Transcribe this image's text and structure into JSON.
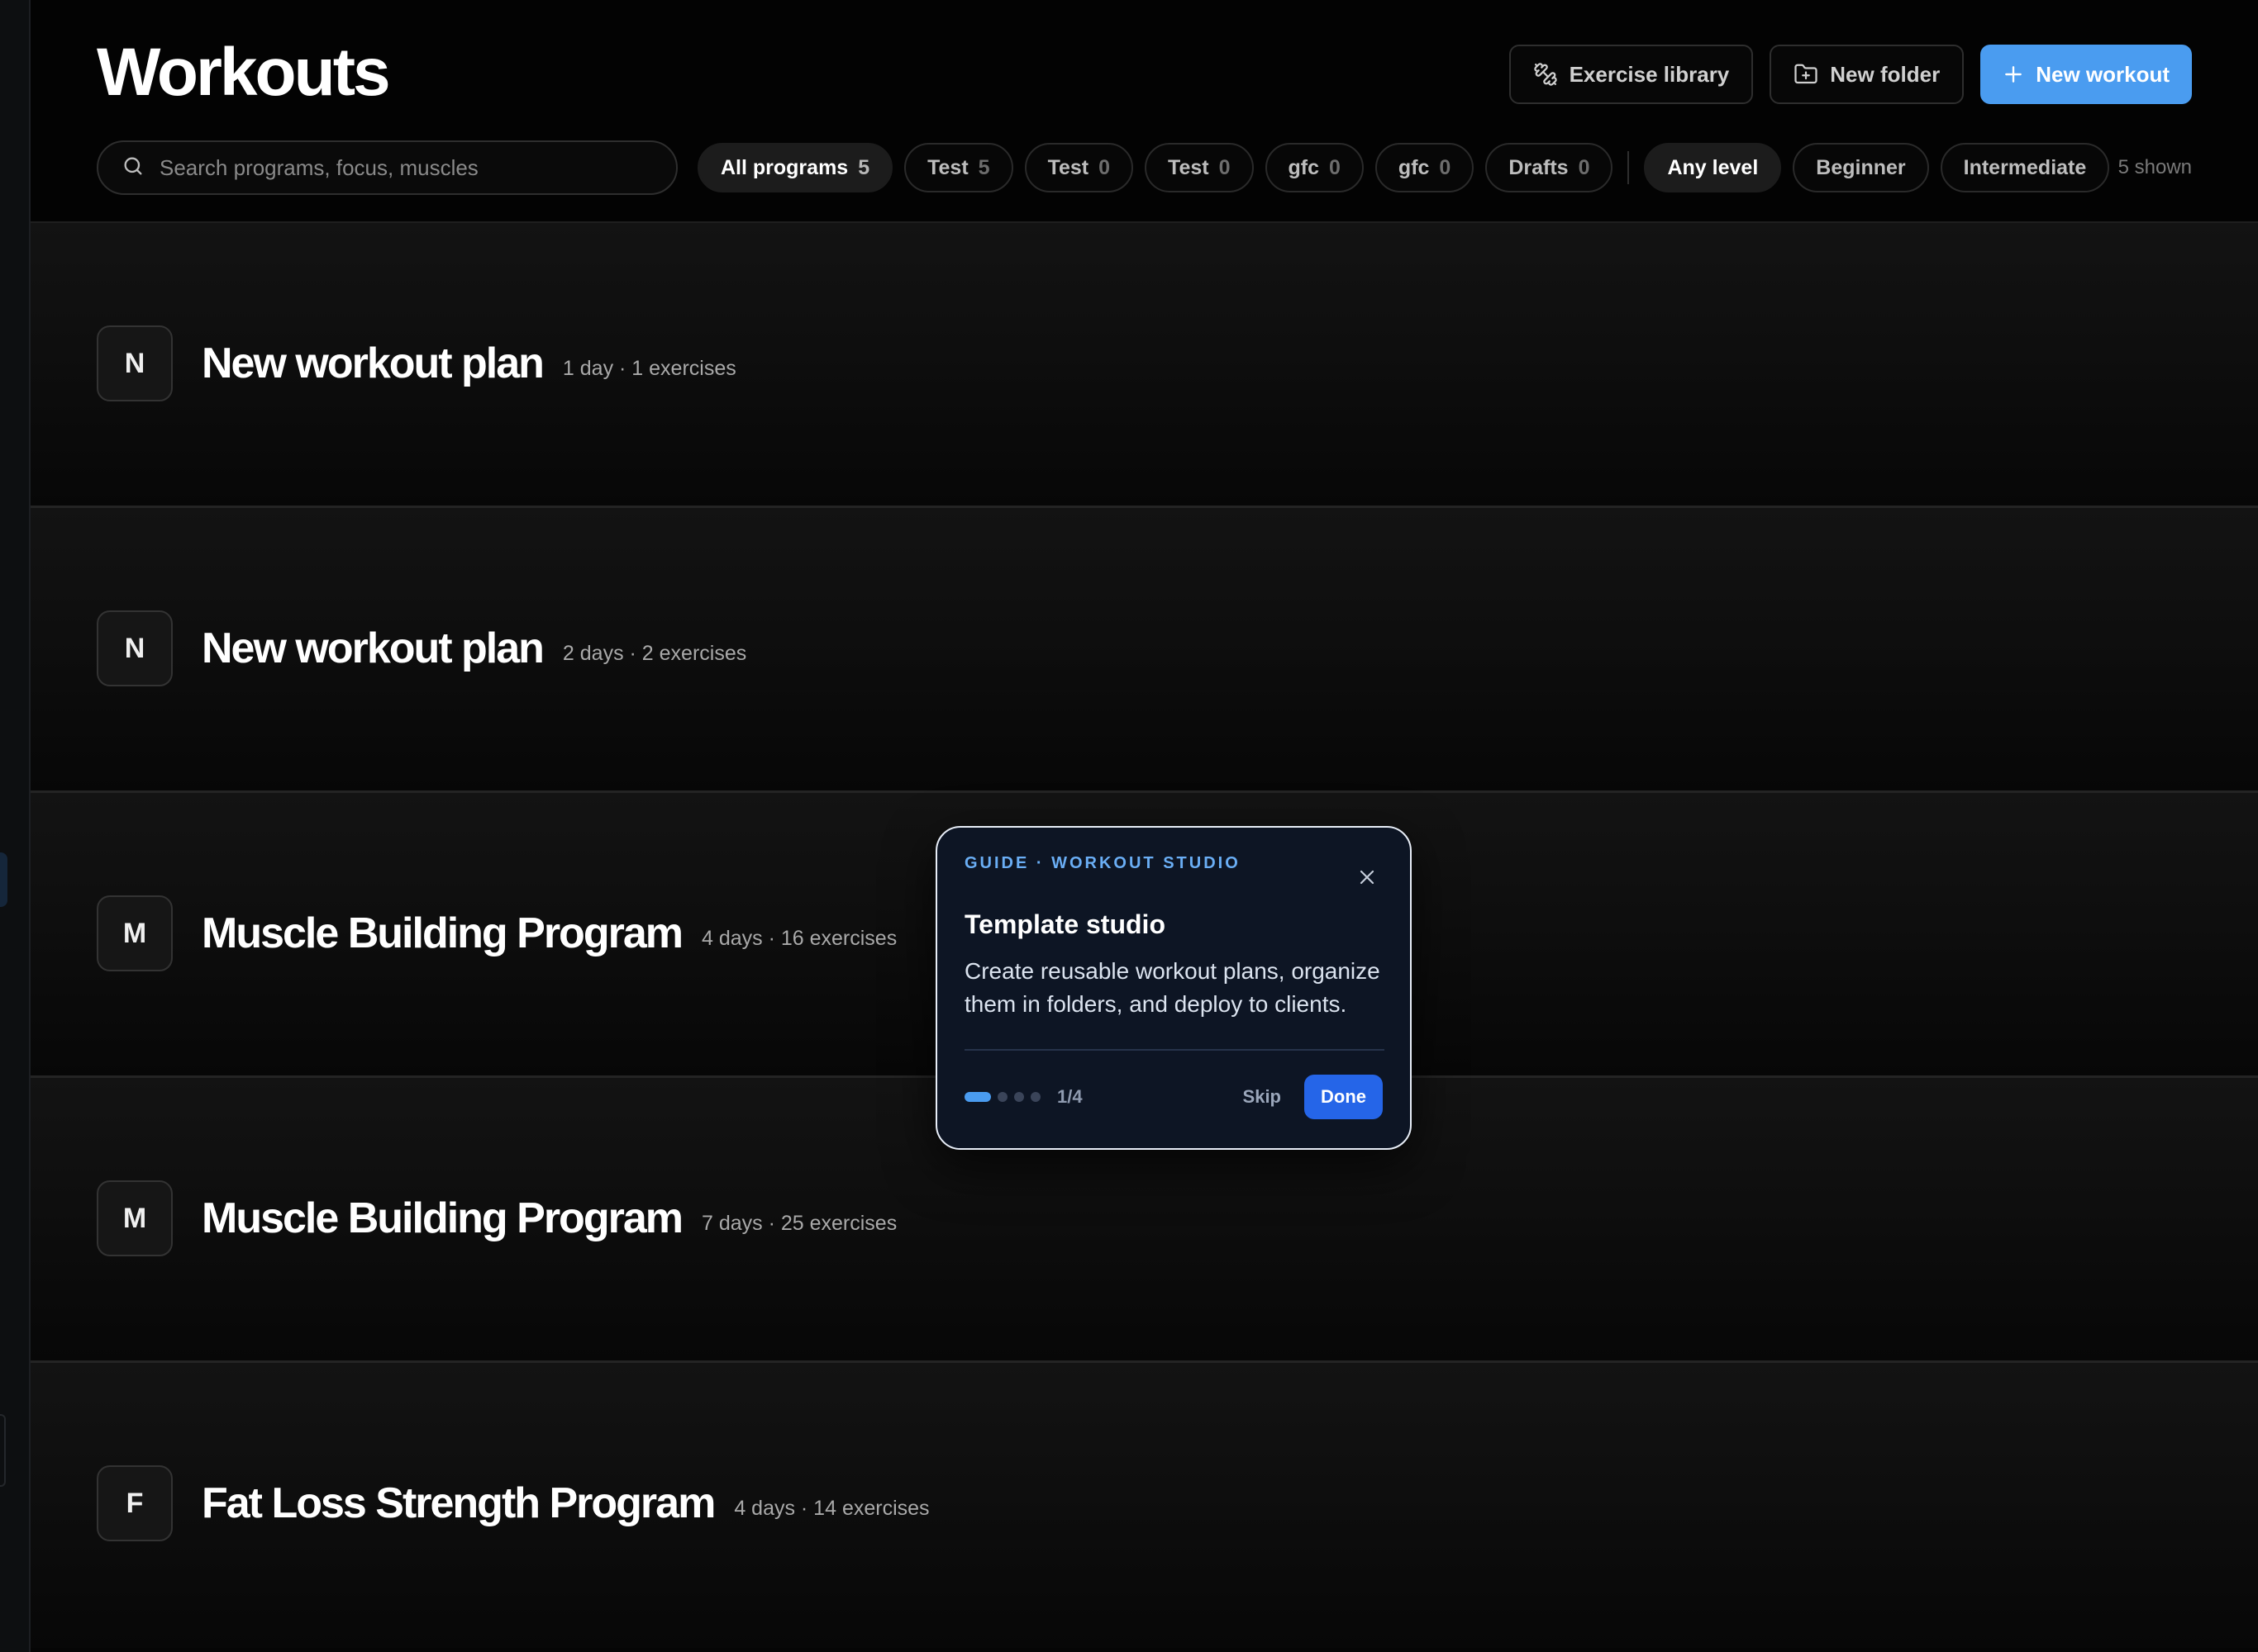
{
  "header": {
    "title": "Workouts",
    "actions": {
      "exercise_library": "Exercise library",
      "new_folder": "New folder",
      "new_workout": "New workout"
    },
    "search": {
      "placeholder": "Search programs, focus, muscles",
      "value": ""
    },
    "program_chips": [
      {
        "label": "All programs",
        "count": "5",
        "active": true
      },
      {
        "label": "Test",
        "count": "5",
        "active": false
      },
      {
        "label": "Test",
        "count": "0",
        "active": false
      },
      {
        "label": "Test",
        "count": "0",
        "active": false
      },
      {
        "label": "gfc",
        "count": "0",
        "active": false
      },
      {
        "label": "gfc",
        "count": "0",
        "active": false
      },
      {
        "label": "Drafts",
        "count": "0",
        "active": false
      }
    ],
    "level_chips": [
      {
        "label": "Any level",
        "active": true
      },
      {
        "label": "Beginner",
        "active": false
      },
      {
        "label": "Intermediate",
        "active": false
      }
    ],
    "shown_count": "5 shown"
  },
  "workouts": [
    {
      "initial": "N",
      "title": "New workout plan",
      "meta": "1 day · 1 exercises"
    },
    {
      "initial": "N",
      "title": "New workout plan",
      "meta": "2 days · 2 exercises"
    },
    {
      "initial": "M",
      "title": "Muscle Building Program",
      "meta": "4 days · 16 exercises"
    },
    {
      "initial": "M",
      "title": "Muscle Building Program",
      "meta": "7 days · 25 exercises"
    },
    {
      "initial": "F",
      "title": "Fat Loss Strength Program",
      "meta": "4 days · 14 exercises"
    }
  ],
  "guide": {
    "eyebrow": "GUIDE · WORKOUT STUDIO",
    "title": "Template studio",
    "body": "Create reusable workout plans, organize them in folders, and deploy to clients.",
    "step": "1/4",
    "total_steps": 4,
    "current_step": 1,
    "skip": "Skip",
    "done": "Done"
  },
  "colors": {
    "background": "#050505",
    "accent": "#4a9cf0",
    "guide_background": "#0d1524",
    "done_button": "#2565e8"
  },
  "icons": {
    "exercise_library": "dumbbell-icon",
    "new_folder": "folder-plus-icon",
    "new_workout": "plus-icon",
    "search": "search-icon",
    "guide_close": "close-icon"
  }
}
